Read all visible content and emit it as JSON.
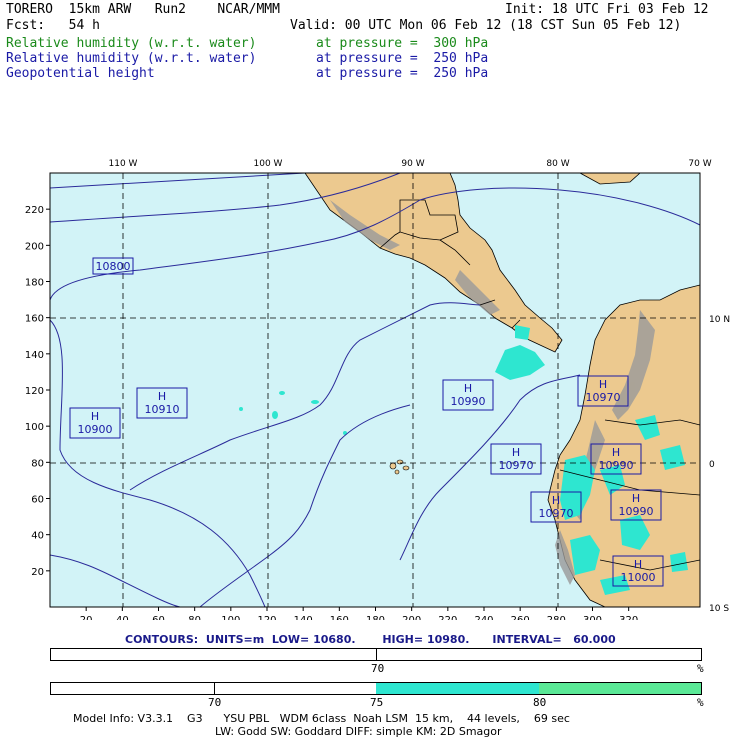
{
  "header": {
    "left1": "TORERO  15km ARW   Run2    NCAR/MMM",
    "left2": "Fcst:   54 h",
    "init": "Init: 18 UTC Fri 03 Feb 12",
    "valid": "Valid: 00 UTC Mon 06 Feb 12 (18 CST Sun 05 Feb 12)",
    "field1": "Relative humidity (w.r.t. water)",
    "field1_p": "at pressure =  300 hPa",
    "field2": "Relative humidity (w.r.t. water)",
    "field2_p": "at pressure =  250 hPa",
    "field3": "Geopotential height",
    "field3_p": "at pressure =  250 hPa"
  },
  "map": {
    "lon_labels": [
      "110 W",
      "100 W",
      "90 W",
      "80 W",
      "70 W"
    ],
    "lat_labels": [
      "10 N",
      "0",
      "10 S"
    ],
    "y_ticks": [
      "220",
      "200",
      "180",
      "160",
      "140",
      "120",
      "100",
      "80",
      "60",
      "40",
      "20"
    ],
    "x_ticks": [
      "20",
      "40",
      "60",
      "80",
      "100",
      "120",
      "140",
      "160",
      "180",
      "200",
      "220",
      "240",
      "260",
      "280",
      "300",
      "320"
    ],
    "height_labels": [
      {
        "kind": "",
        "value": "10800"
      },
      {
        "kind": "H",
        "value": "10910"
      },
      {
        "kind": "H",
        "value": "10900"
      },
      {
        "kind": "H",
        "value": "10990"
      },
      {
        "kind": "H",
        "value": "10970"
      },
      {
        "kind": "H",
        "value": "10970"
      },
      {
        "kind": "H",
        "value": "10990"
      },
      {
        "kind": "H",
        "value": "10970"
      },
      {
        "kind": "H",
        "value": "10990"
      },
      {
        "kind": "H",
        "value": "11000"
      }
    ],
    "colors": {
      "ocean": "#d2f3f7",
      "land": "#ecc98f",
      "terrain": "#8a8a8a",
      "humidity": "#2ee6d0"
    }
  },
  "contours": {
    "label": "CONTOURS:",
    "units": "UNITS=m",
    "low_label": "LOW=",
    "low": "10680.",
    "high_label": "HIGH=",
    "high": "10980.",
    "interval_label": "INTERVAL=",
    "interval": "60.000"
  },
  "scale1": {
    "tick": "70",
    "pct": "%"
  },
  "scale2": {
    "ticks": [
      "70",
      "75",
      "80"
    ],
    "pct": "%",
    "colors": [
      "#2ee6d0",
      "#5ae896"
    ]
  },
  "footer": {
    "line1": "Model Info: V3.3.1    G3      YSU PBL   WDM 6class  Noah LSM  15 km,    44 levels,    69 sec",
    "line2": "LW: Godd SW: Goddard DIFF: simple KM: 2D Smagor"
  }
}
